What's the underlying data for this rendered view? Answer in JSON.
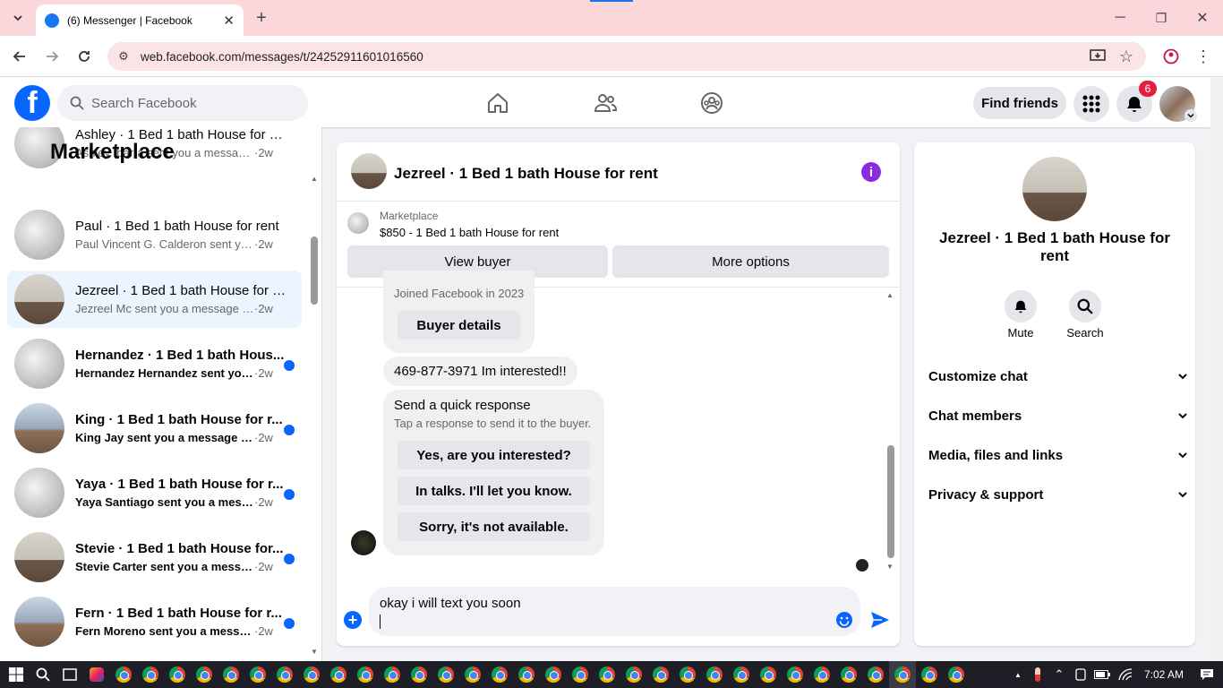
{
  "browser": {
    "tab_title": "(6) Messenger | Facebook",
    "url": "web.facebook.com/messages/t/24252911601016560"
  },
  "header": {
    "search_placeholder": "Search Facebook",
    "find_friends": "Find friends",
    "notification_count": "6"
  },
  "sidebar": {
    "title": "Marketplace",
    "conversations": [
      {
        "name": "Ashley · 1 Bed 1 bath House for rent",
        "preview": "Ashley Ibarra sent you a message a...",
        "age": "·2w",
        "unread": false,
        "active": false,
        "thumb": "t1"
      },
      {
        "name": "Paul · 1 Bed 1 bath House for rent",
        "preview": "Paul Vincent G. Calderon sent you ...",
        "age": "·2w",
        "unread": false,
        "active": false,
        "thumb": "t1"
      },
      {
        "name": "Jezreel · 1 Bed 1 bath House for r...",
        "preview": "Jezreel Mc sent you a message abo...",
        "age": "·2w",
        "unread": false,
        "active": true,
        "thumb": "t2"
      },
      {
        "name": "Hernandez · 1 Bed 1 bath Hous...",
        "preview": "Hernandez Hernandez sent you...",
        "age": "·2w",
        "unread": true,
        "active": false,
        "thumb": "t1"
      },
      {
        "name": "King · 1 Bed 1 bath House for r...",
        "preview": "King Jay sent you a message ab...",
        "age": "·2w",
        "unread": true,
        "active": false,
        "thumb": "t3"
      },
      {
        "name": "Yaya · 1 Bed 1 bath House for r...",
        "preview": "Yaya Santiago sent you a messa...",
        "age": "·2w",
        "unread": true,
        "active": false,
        "thumb": "t1"
      },
      {
        "name": "Stevie · 1 Bed 1 bath House for...",
        "preview": "Stevie Carter sent you a messag...",
        "age": "·2w",
        "unread": true,
        "active": false,
        "thumb": "t2"
      },
      {
        "name": "Fern · 1 Bed 1 bath House for r...",
        "preview": "Fern Moreno sent you a messag...",
        "age": "·2w",
        "unread": true,
        "active": false,
        "thumb": "t3"
      }
    ]
  },
  "chat": {
    "title": "Jezreel · 1 Bed 1 bath House for rent",
    "listing_label": "Marketplace",
    "listing_desc": "$850 - 1 Bed 1 bath House for rent",
    "view_buyer": "View buyer",
    "more_options": "More options",
    "joined": "Joined Facebook in 2023",
    "buyer_details": "Buyer details",
    "message": "469-877-3971 Im interested!!",
    "quick_title": "Send a quick response",
    "quick_sub": "Tap a response to send it to the buyer.",
    "quick_responses": [
      "Yes, are you interested?",
      "In talks. I'll let you know.",
      "Sorry, it's not available."
    ],
    "composer_text": "okay i will text you soon"
  },
  "details": {
    "title": "Jezreel · 1 Bed 1 bath House for rent",
    "mute": "Mute",
    "search": "Search",
    "rows": [
      "Customize chat",
      "Chat members",
      "Media, files and links",
      "Privacy & support"
    ]
  },
  "taskbar": {
    "time": "7:02 AM"
  },
  "colors": {
    "brand": "#0866ff",
    "tab_bar": "#fbd7dc",
    "badge": "#e41e3f",
    "info": "#8a2be2"
  }
}
